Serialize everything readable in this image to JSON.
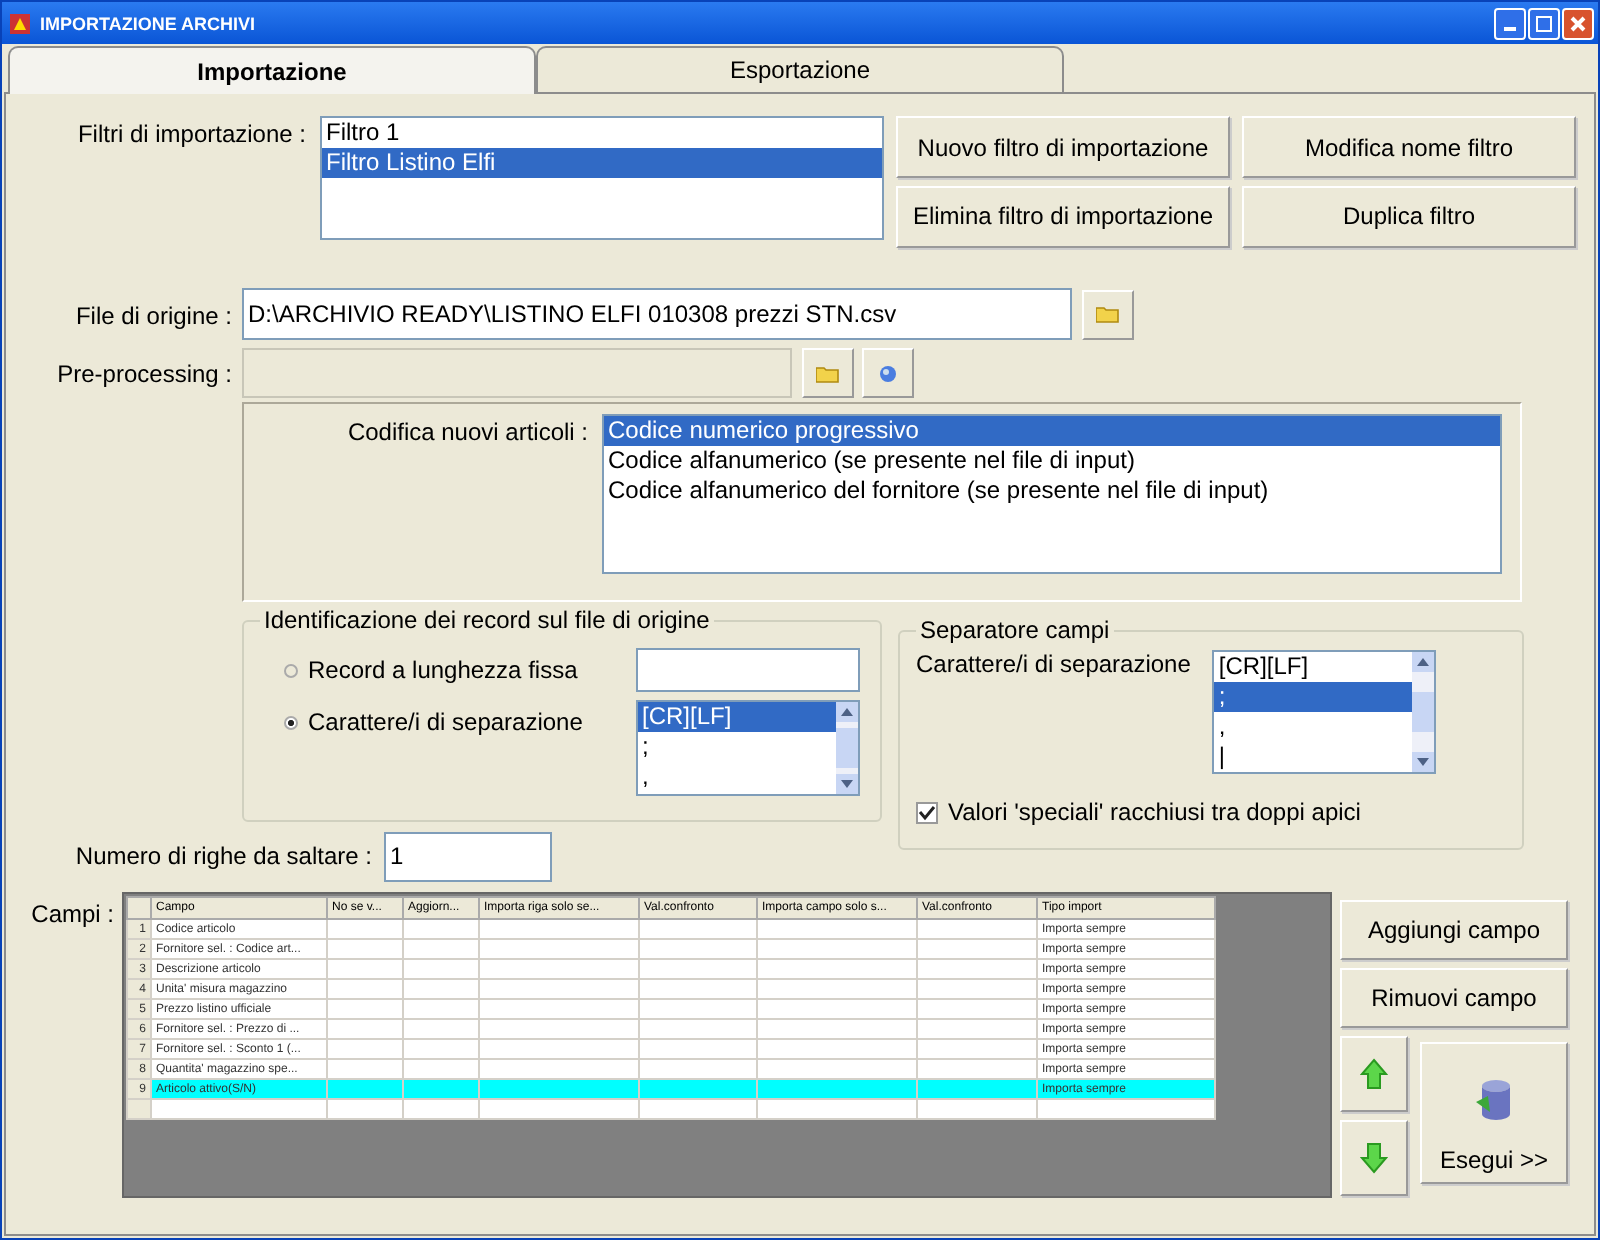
{
  "window": {
    "title": "IMPORTAZIONE ARCHIVI"
  },
  "tabs": [
    {
      "label": "Importazione",
      "selected": true
    },
    {
      "label": "Esportazione",
      "selected": false
    }
  ],
  "filters": {
    "label": "Filtri di importazione :",
    "items": [
      {
        "label": "Filtro 1",
        "selected": false
      },
      {
        "label": "Filtro Listino Elfi",
        "selected": true
      }
    ]
  },
  "filter_buttons": [
    "Nuovo filtro di importazione",
    "Modifica nome filtro",
    "Elimina filtro di importazione",
    "Duplica filtro"
  ],
  "source_file": {
    "label": "File di origine :",
    "value": "D:\\ARCHIVIO READY\\LISTINO ELFI 010308 prezzi STN.csv"
  },
  "preprocessing": {
    "label": "Pre-processing :",
    "disabled": true
  },
  "new_codes": {
    "label": "Codifica nuovi articoli :",
    "items": [
      {
        "label": "Codice numerico progressivo",
        "selected": true
      },
      {
        "label": "Codice alfanumerico (se presente nel file di input)",
        "selected": false
      },
      {
        "label": "Codice alfanumerico del fornitore (se presente nel file di input)",
        "selected": false
      }
    ]
  },
  "record_identification": {
    "title": "Identificazione dei record sul file di origine",
    "options": [
      {
        "label": "Record a lunghezza fissa",
        "selected": false
      },
      {
        "label": "Carattere/i di separazione",
        "selected": true
      }
    ],
    "separators": [
      {
        "label": "[CR][LF]",
        "selected": true
      },
      {
        "label": ";",
        "selected": false
      },
      {
        "label": ",",
        "selected": false
      }
    ]
  },
  "field_separator": {
    "title": "Separatore campi",
    "label": "Carattere/i di separazione",
    "items": [
      {
        "label": "[CR][LF]",
        "selected": false
      },
      {
        "label": ";",
        "selected": true
      },
      {
        "label": ",",
        "selected": false
      },
      {
        "label": "|",
        "selected": false
      }
    ],
    "quoted_values": {
      "label": "Valori 'speciali' racchiusi tra doppi apici",
      "checked": true
    }
  },
  "skip_rows": {
    "label": "Numero di righe da saltare  :",
    "value": "1"
  },
  "fields": {
    "label": "Campi :",
    "columns": [
      "Campo",
      "No se v...",
      "Aggiorn...",
      "Importa riga solo se...",
      "Val.confronto",
      "Importa campo solo s...",
      "Val.confronto",
      "Tipo import"
    ],
    "rows": [
      {
        "number": "1",
        "campo": "Codice articolo",
        "tipo_import": "Importa sempre",
        "selected": false
      },
      {
        "number": "2",
        "campo": "Fornitore sel. : Codice art...",
        "tipo_import": "Importa sempre",
        "selected": false
      },
      {
        "number": "3",
        "campo": "Descrizione articolo",
        "tipo_import": "Importa sempre",
        "selected": false
      },
      {
        "number": "4",
        "campo": "Unita' misura magazzino",
        "tipo_import": "Importa sempre",
        "selected": false
      },
      {
        "number": "5",
        "campo": "Prezzo listino ufficiale",
        "tipo_import": "Importa sempre",
        "selected": false
      },
      {
        "number": "6",
        "campo": "Fornitore sel. : Prezzo di ...",
        "tipo_import": "Importa sempre",
        "selected": false
      },
      {
        "number": "7",
        "campo": "Fornitore sel. : Sconto 1 (...",
        "tipo_import": "Importa sempre",
        "selected": false
      },
      {
        "number": "8",
        "campo": "Quantita' magazzino spe...",
        "tipo_import": "Importa sempre",
        "selected": false
      },
      {
        "number": "9",
        "campo": "Articolo attivo(S/N)",
        "tipo_import": "Importa sempre",
        "selected": true
      }
    ]
  },
  "field_buttons": [
    "Aggiungi campo",
    "Rimuovi campo"
  ],
  "run_button": {
    "label": "Esegui >>"
  }
}
